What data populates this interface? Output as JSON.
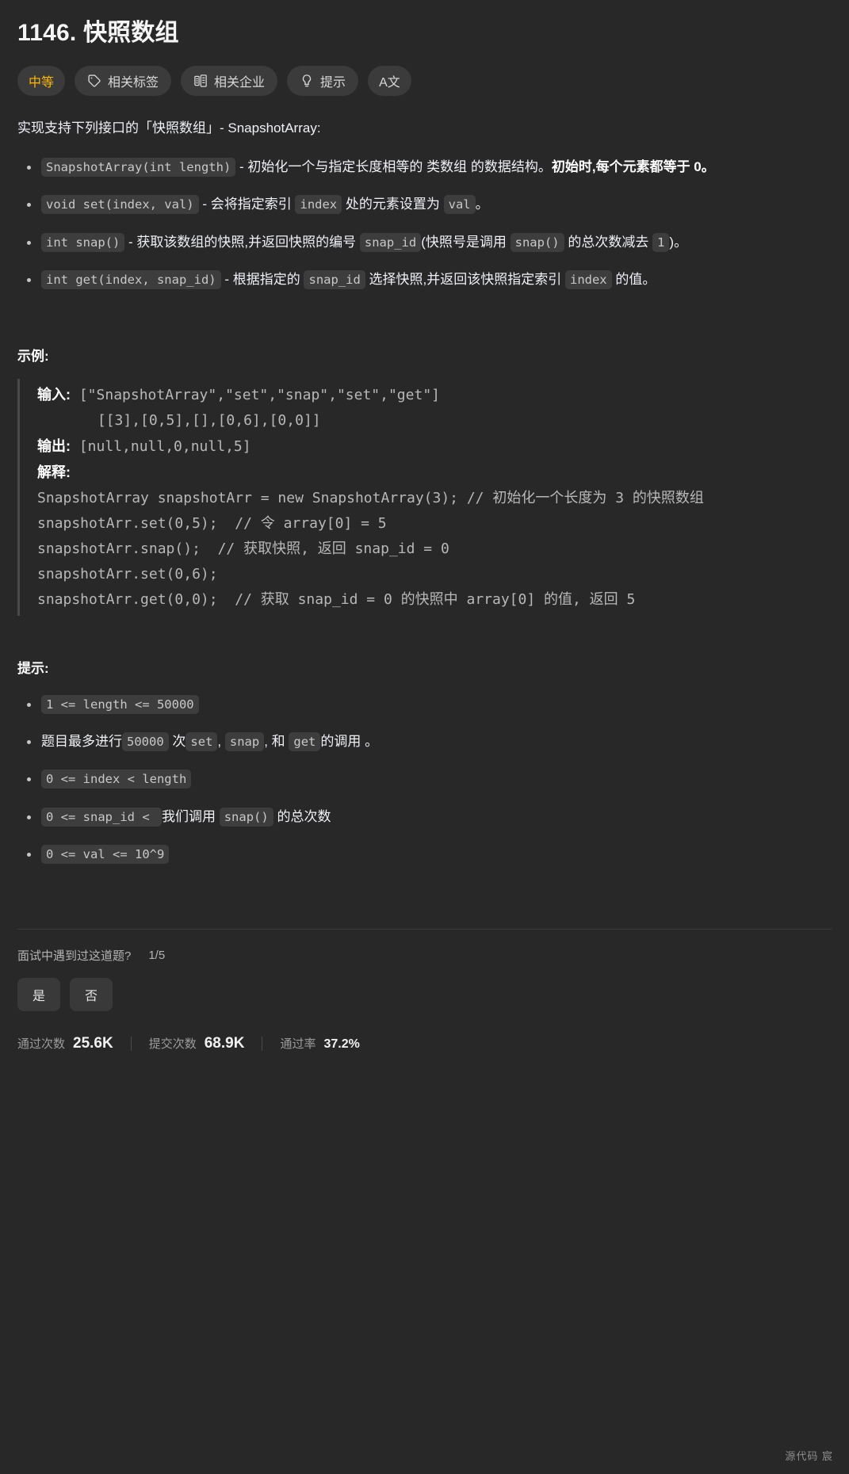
{
  "header": {
    "title": "1146. 快照数组",
    "badges": [
      {
        "label": "中等",
        "icon": "none",
        "kind": "difficulty"
      },
      {
        "label": "相关标签",
        "icon": "tag-icon",
        "kind": "normal"
      },
      {
        "label": "相关企业",
        "icon": "company-icon",
        "kind": "normal"
      },
      {
        "label": "提示",
        "icon": "lightbulb-icon",
        "kind": "normal"
      },
      {
        "label": "A文",
        "icon": "translate-icon",
        "kind": "icon-only"
      }
    ]
  },
  "description": {
    "intro": "实现支持下列接口的「快照数组」- SnapshotArray:",
    "items": [
      {
        "code": "SnapshotArray(int length)",
        "text_a": " - 初始化一个与指定长度相等的 类数组 的数据结构。",
        "bold": "初始时,每个元素都等于 0。"
      },
      {
        "code": "void set(index, val)",
        "text_a": " - 会将指定索引 ",
        "code2": "index",
        "text_b": " 处的元素设置为 ",
        "code3": "val",
        "text_c": "。"
      },
      {
        "code": "int snap()",
        "text_a": " - 获取该数组的快照,并返回快照的编号 ",
        "code2": "snap_id",
        "text_b": "(快照号是调用 ",
        "code3": "snap()",
        "text_c": " 的总次数减去 ",
        "code4": "1",
        "text_d": ")。"
      },
      {
        "code": "int get(index, snap_id)",
        "text_a": " - 根据指定的 ",
        "code2": "snap_id",
        "text_b": " 选择快照,并返回该快照指定索引 ",
        "code3": "index",
        "text_c": " 的值。"
      }
    ]
  },
  "example": {
    "heading": "示例:",
    "input_label": "输入:",
    "input_line1": "[\"SnapshotArray\",\"set\",\"snap\",\"set\",\"get\"]",
    "input_line2": "[[3],[0,5],[],[0,6],[0,0]]",
    "output_label": "输出:",
    "output_value": "[null,null,0,null,5]",
    "explain_label": "解释:",
    "explain_body": "SnapshotArray snapshotArr = new SnapshotArray(3); // 初始化一个长度为 3 的快照数组\nsnapshotArr.set(0,5);  // 令 array[0] = 5\nsnapshotArr.snap();  // 获取快照, 返回 snap_id = 0\nsnapshotArr.set(0,6);\nsnapshotArr.get(0,0);  // 获取 snap_id = 0 的快照中 array[0] 的值, 返回 5"
  },
  "constraints": {
    "heading": "提示:",
    "items": [
      {
        "code": "1 <= length <= 50000"
      },
      {
        "text_a": "题目最多进行",
        "code": "50000",
        "text_b": " 次",
        "code2": "set",
        "text_c": ", ",
        "code3": "snap",
        "text_d": ", 和 ",
        "code4": "get",
        "text_e": "的调用 。"
      },
      {
        "code": "0 <= index < length"
      },
      {
        "code": "0 <= snap_id < ",
        "text_b": "我们调用 ",
        "code2": "snap()",
        "text_c": " 的总次数"
      },
      {
        "code": "0 <= val <= 10^9"
      }
    ]
  },
  "footer": {
    "poll_question": "面试中遇到过这道题?",
    "poll_count": "1/5",
    "poll_yes": "是",
    "poll_no": "否",
    "stats": [
      {
        "key": "通过次数",
        "value": "25.6K",
        "small": false
      },
      {
        "key": "提交次数",
        "value": "68.9K",
        "small": false
      },
      {
        "key": "通过率",
        "value": "37.2%",
        "small": true
      }
    ],
    "watermark": "源代码 宸"
  },
  "colors": {
    "background": "#282828",
    "difficulty": "#ffb800",
    "code_bg": "#3d3d3d",
    "badge_bg": "#3b3b3b"
  }
}
